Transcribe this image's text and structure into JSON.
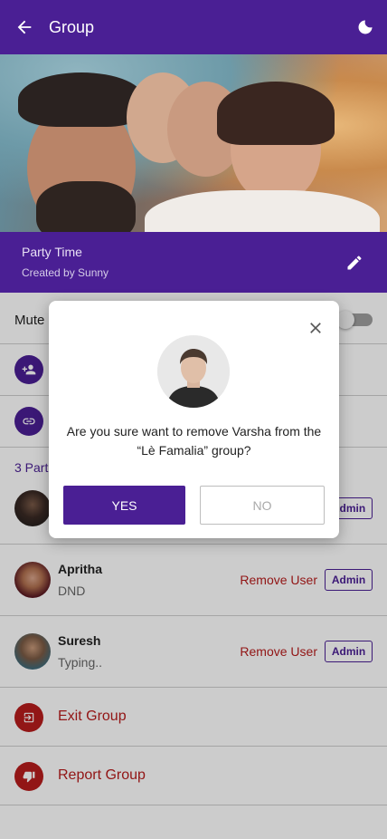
{
  "app_bar": {
    "title": "Group"
  },
  "group": {
    "name": "Party Time",
    "created_by": "Created by Sunny"
  },
  "mute": {
    "label": "Mute",
    "enabled": false
  },
  "participants": {
    "label": "3 Part",
    "users": [
      {
        "name": "",
        "status": "",
        "remove_label": "",
        "admin_label": "Admin"
      },
      {
        "name": "Apritha",
        "status": "DND",
        "remove_label": "Remove User",
        "admin_label": "Admin"
      },
      {
        "name": "Suresh",
        "status": "Typing..",
        "remove_label": "Remove User",
        "admin_label": "Admin"
      }
    ]
  },
  "actions": {
    "exit_label": "Exit Group",
    "report_label": "Report Group"
  },
  "dialog": {
    "message": "Are you sure want to remove Varsha  from the “Lè Famalia” group?",
    "yes_label": "YES",
    "no_label": "NO"
  },
  "colors": {
    "primary": "#4a1f94",
    "danger": "#b71c1c"
  }
}
